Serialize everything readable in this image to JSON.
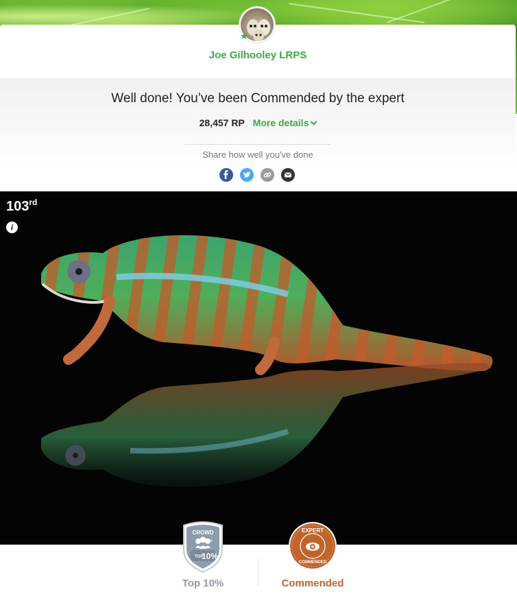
{
  "user": {
    "name": "Joe Gilhooley LRPS"
  },
  "result": {
    "headline": "Well done! You’ve been Commended by the expert",
    "points": "28,457 RP",
    "more_details_label": "More details"
  },
  "share": {
    "prompt": "Share how well you've done",
    "buttons": [
      {
        "icon": "facebook-icon",
        "glyph": "f",
        "color": "#3b5998"
      },
      {
        "icon": "twitter-icon",
        "glyph": "t",
        "color": "#4aa8ee"
      },
      {
        "icon": "link-icon",
        "glyph": "∞",
        "color": "#9a9a9a"
      },
      {
        "icon": "email-icon",
        "glyph": "✉",
        "color": "#333333"
      }
    ]
  },
  "photo": {
    "rank_number": "103",
    "rank_suffix": "rd"
  },
  "badges": {
    "crowd": {
      "title": "CROWD",
      "top_text": "TOP",
      "percent_text": "10%",
      "label": "Top 10%",
      "color": "#8e9bab"
    },
    "expert": {
      "title": "EXPERT",
      "ring_text": "COMMENDED",
      "label": "Commended",
      "color": "#c0642b"
    }
  },
  "colors": {
    "accent_green": "#3aa845",
    "expert_orange": "#c0642b"
  }
}
